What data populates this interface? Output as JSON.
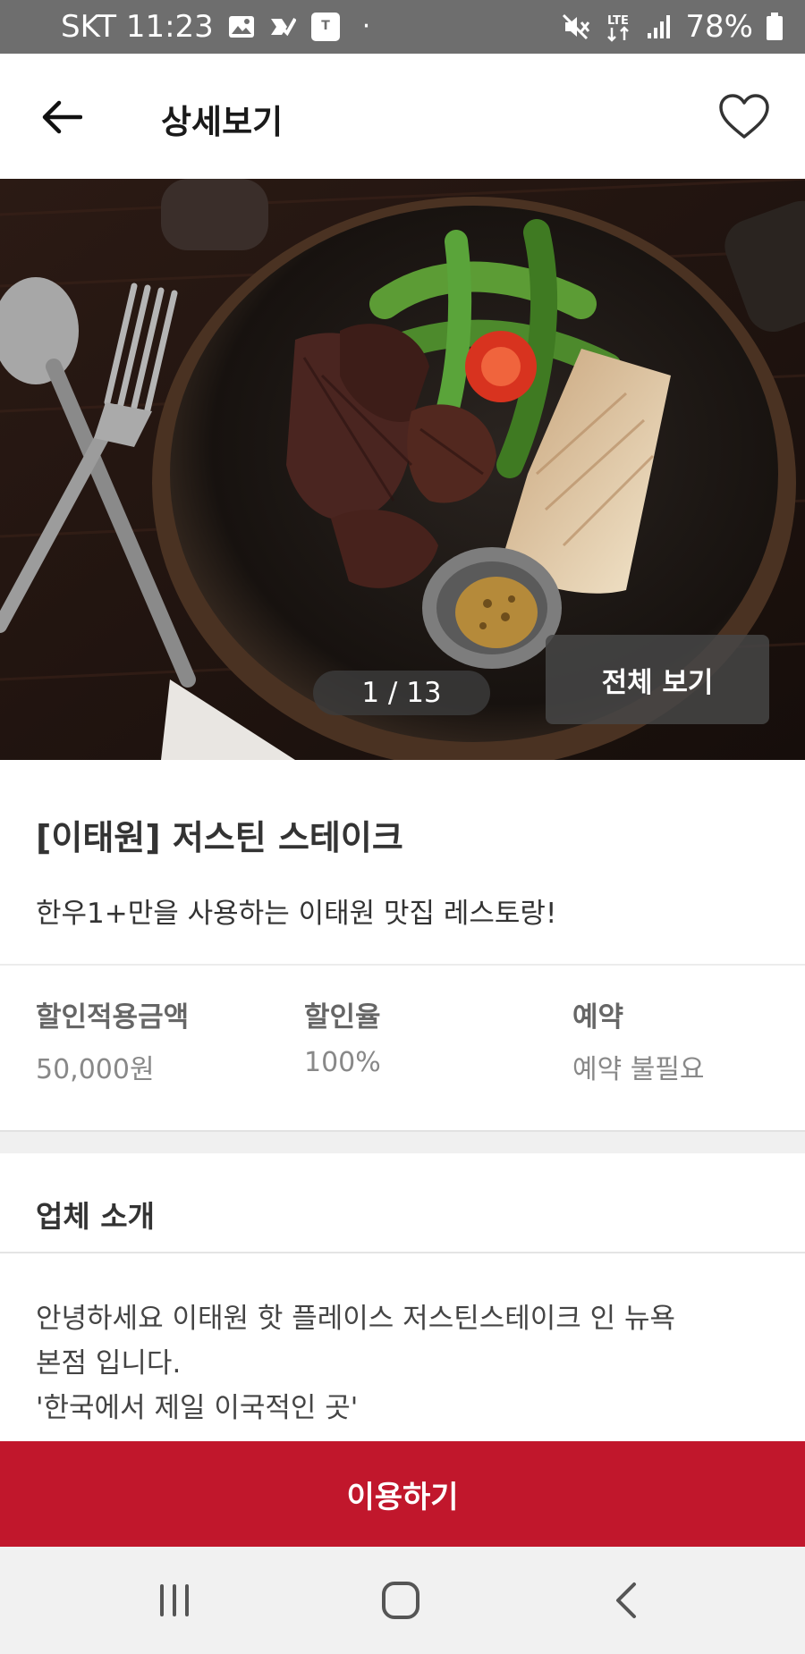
{
  "status_bar": {
    "carrier_time": "SKT 11:23",
    "battery": "78%",
    "network": "LTE"
  },
  "header": {
    "title": "상세보기"
  },
  "hero": {
    "counter": "1 / 13",
    "view_all_label": "전체 보기"
  },
  "store": {
    "name": "[이태원] 저스틴 스테이크",
    "tagline": "한우1+만을 사용하는 이태원 맛집 레스토랑!"
  },
  "stats": [
    {
      "label": "할인적용금액",
      "value": "50,000원"
    },
    {
      "label": "할인율",
      "value": "100%"
    },
    {
      "label": "예약",
      "value": "예약 불필요"
    }
  ],
  "intro": {
    "title": "업체 소개",
    "lines": [
      "안녕하세요 이태원 핫 플레이스 저스틴스테이크 인 뉴욕",
      "본점 입니다.",
      "'한국에서 제일 이국적인 곳'"
    ]
  },
  "cta": {
    "label": "이용하기"
  },
  "colors": {
    "accent": "#c1172c",
    "status_bar": "#6e6e6e"
  },
  "icons": {
    "back": "arrow-left-icon",
    "favorite": "heart-outline-icon",
    "nav_recents": "recents-icon",
    "nav_home": "home-icon",
    "nav_back": "chevron-left-icon"
  }
}
